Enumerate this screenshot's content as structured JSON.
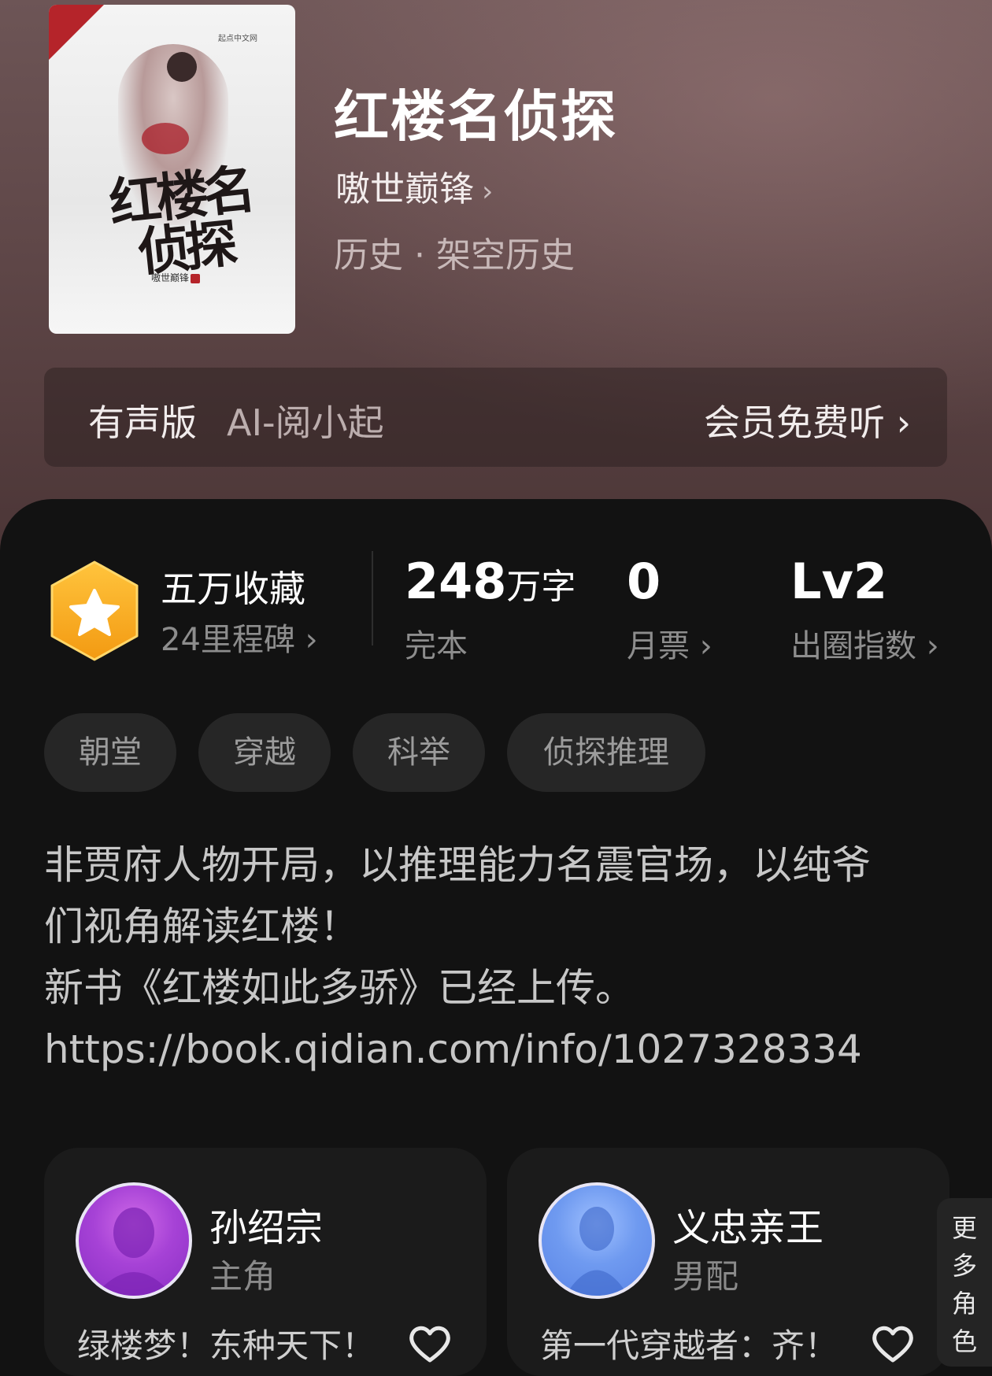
{
  "book": {
    "title": "红楼名侦探",
    "author": "嗷世巅锋",
    "author_chevron": "›",
    "genre": "历史 · 架空历史",
    "cover": {
      "art_title": "红楼名侦探",
      "publisher": "起点中文网",
      "author": "嗷世巅锋",
      "author_seal": "著"
    }
  },
  "audio": {
    "label": "有声版",
    "voice": "AI-阅小起",
    "cta": "会员免费听 ›"
  },
  "stats": {
    "milestone_title": "五万收藏",
    "milestone_sub": "24里程碑 ›",
    "words_num": "248",
    "words_unit": "万字",
    "words_sub": "完本",
    "monthly_num": "0",
    "monthly_sub": "月票 ›",
    "level_num": "Lv2",
    "level_sub": "出圈指数 ›"
  },
  "tags": [
    "朝堂",
    "穿越",
    "科举",
    "侦探推理"
  ],
  "description": {
    "line1": "非贾府人物开局，以推理能力名震官场，以纯爷",
    "line2": "们视角解读红楼！",
    "line3": "新书《红楼如此多骄》已经上传。",
    "line4": "https://book.qidian.com/info/1027328334"
  },
  "roles": [
    {
      "name": "孙绍宗",
      "type": "主角",
      "quote": "绿楼梦！东种天下！"
    },
    {
      "name": "义忠亲王",
      "type": "男配",
      "quote": "第一代穿越者：齐！"
    }
  ],
  "more_roles": [
    "更",
    "多",
    "角",
    "色"
  ],
  "colors": {
    "hero_bg": "#5f4748",
    "panel_bg": "#121212",
    "badge": "#f5a623",
    "cover_corner": "#b5242a"
  }
}
